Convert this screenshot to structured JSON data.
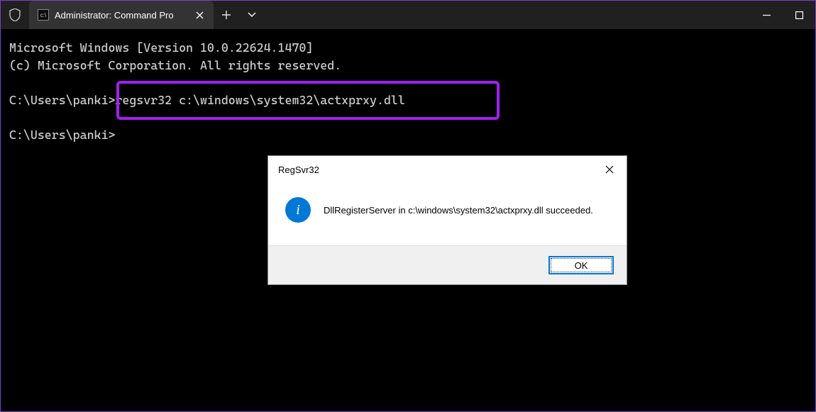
{
  "titlebar": {
    "tab_title": "Administrator: Command Pro",
    "close_icon": "✕",
    "new_tab_icon": "＋",
    "dropdown_icon": "⌄",
    "minimize_icon": "—",
    "maximize_icon": "☐"
  },
  "terminal": {
    "line1": "Microsoft Windows [Version 10.0.22624.1470]",
    "line2": "(c) Microsoft Corporation. All rights reserved.",
    "blank": "",
    "prompt1_path": "C:\\Users\\panki>",
    "prompt1_cmd": "regsvr32 c:\\windows\\system32\\actxprxy.dll",
    "prompt2": "C:\\Users\\panki>"
  },
  "dialog": {
    "title": "RegSvr32",
    "message": "DllRegisterServer in c:\\windows\\system32\\actxprxy.dll succeeded.",
    "ok_label": "OK",
    "info_glyph": "i",
    "close_icon": "✕"
  }
}
